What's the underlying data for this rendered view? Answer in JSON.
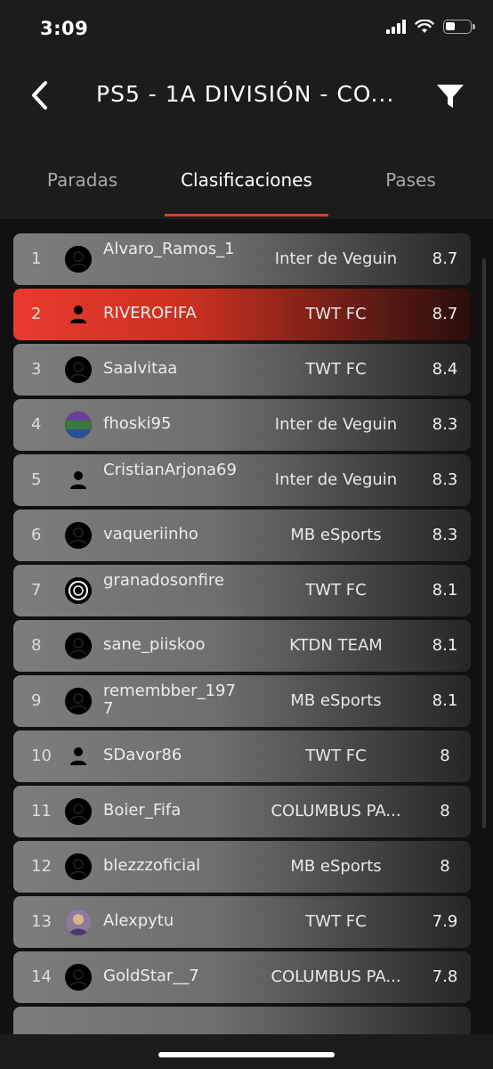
{
  "status": {
    "time": "3:09"
  },
  "nav": {
    "title": "PS5 - 1A DIVISIÓN - CO..."
  },
  "tabs": [
    {
      "label": "Paradas",
      "active": false
    },
    {
      "label": "Clasificaciones",
      "active": true
    },
    {
      "label": "Pases",
      "active": false
    }
  ],
  "rows": [
    {
      "rank": "1",
      "player": "Alvaro_Ramos_1",
      "team": "Inter de Veguin",
      "rating": "8.7"
    },
    {
      "rank": "2",
      "player": "RIVEROFIFA",
      "team": "TWT FC",
      "rating": "8.7"
    },
    {
      "rank": "3",
      "player": "Saalvitaa",
      "team": "TWT FC",
      "rating": "8.4"
    },
    {
      "rank": "4",
      "player": "fhoski95",
      "team": "Inter de Veguin",
      "rating": "8.3"
    },
    {
      "rank": "5",
      "player": "CristianArjona69",
      "team": "Inter de Veguin",
      "rating": "8.3"
    },
    {
      "rank": "6",
      "player": "vaqueriinho",
      "team": "MB eSports",
      "rating": "8.3"
    },
    {
      "rank": "7",
      "player": "granadosonfire",
      "team": "TWT FC",
      "rating": "8.1"
    },
    {
      "rank": "8",
      "player": "sane_piiskoo",
      "team": "KTDN TEAM",
      "rating": "8.1"
    },
    {
      "rank": "9",
      "player": "remembber_1977",
      "team": "MB eSports",
      "rating": "8.1"
    },
    {
      "rank": "10",
      "player": "SDavor86",
      "team": "TWT FC",
      "rating": "8"
    },
    {
      "rank": "11",
      "player": "Boier_Fifa",
      "team": "COLUMBUS PA...",
      "rating": "8"
    },
    {
      "rank": "12",
      "player": "blezzzoficial",
      "team": "MB eSports",
      "rating": "8"
    },
    {
      "rank": "13",
      "player": "Alexpytu",
      "team": "TWT FC",
      "rating": "7.9"
    },
    {
      "rank": "14",
      "player": "GoldStar__7",
      "team": "COLUMBUS PA...",
      "rating": "7.8"
    }
  ],
  "colors": {
    "accent": "#e23c2f",
    "background": "#1c1c1c"
  }
}
